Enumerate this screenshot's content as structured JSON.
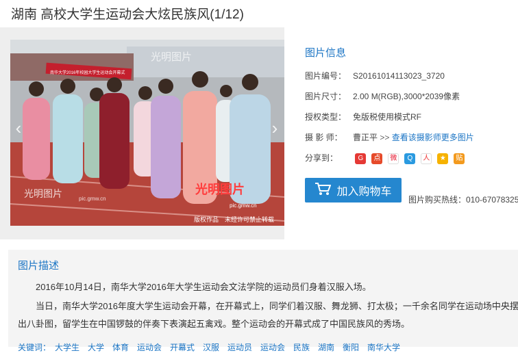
{
  "page": {
    "title": "湖南 高校大学生运动会大炫民族风(1/12)"
  },
  "photo": {
    "banner_text": "南华大学2016年校园大学生运动会开幕式",
    "watermark": "光明图片",
    "watermark_url": "pic.gmw.cn",
    "copyright": "版权作品　未经许可禁止转载"
  },
  "info": {
    "title": "图片信息",
    "rows": [
      {
        "key": "图片编号：",
        "value": "S20161014113023_3720"
      },
      {
        "key": "图片尺寸：",
        "value": "2.00 M(RGB),3000*2039像素"
      },
      {
        "key": "授权类型：",
        "value": "免版税使用模式RF"
      },
      {
        "key": "摄 影 师：",
        "value": "曹正平",
        "link": "查看该摄影师更多图片"
      }
    ],
    "share_label": "分享到：",
    "share_icons": [
      "google-icon",
      "diandian-icon",
      "weibo-icon",
      "qzone-icon",
      "renren-icon",
      "kaixin-icon",
      "tieba-icon"
    ]
  },
  "cart": {
    "label": "加入购物车"
  },
  "hotline": "图片购买热线：010-67078325",
  "description": {
    "title": "图片描述",
    "p1": "2016年10月14日，南华大学2016年大学生运动会文法学院的运动员们身着汉服入场。",
    "p2": "当日，南华大学2016年度大学生运动会开幕，在开幕式上，同学们着汉服、舞龙狮、打太极；一千余名同学在运动场中央摆出八卦图，留学生在中国锣鼓的伴奏下表演起五禽戏。整个运动会的开幕式成了中国民族风的秀场。",
    "tags": "关键词：　大学生　大学　体育　运动会　开幕式　汉服　运动员　运动会　民族　湖南　衡阳　南华大学"
  },
  "colors": {
    "link": "#1a74c4",
    "button": "#2587cf"
  }
}
